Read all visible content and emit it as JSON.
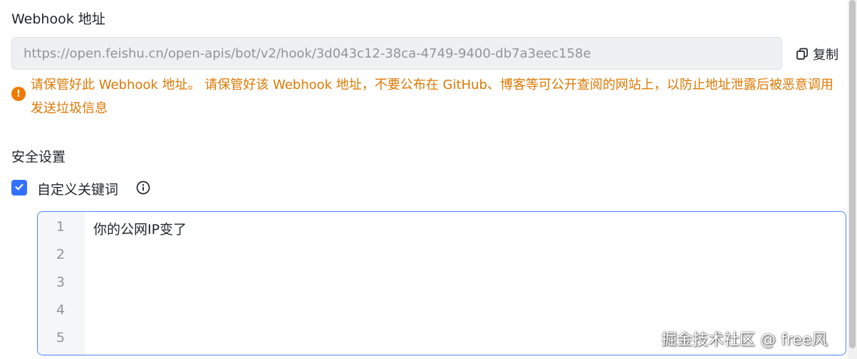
{
  "webhook": {
    "label": "Webhook 地址",
    "url": "https://open.feishu.cn/open-apis/bot/v2/hook/3d043c12-38ca-4749-9400-db7a3eec158e",
    "copy_label": "复制"
  },
  "warning": {
    "icon": "exclamation-icon",
    "text": "请保管好此 Webhook 地址。 请保管好该 Webhook 地址，不要公布在 GitHub、博客等可公开查阅的网站上，以防止地址泄露后被恶意调用发送垃圾信息"
  },
  "security": {
    "label": "安全设置",
    "keyword_option": {
      "label": "自定义关键词",
      "checked": true
    }
  },
  "editor": {
    "line_numbers": [
      "1",
      "2",
      "3",
      "4",
      "5"
    ],
    "lines": [
      "你的公网IP变了"
    ]
  },
  "watermark": "掘金技术社区 @ free风",
  "colors": {
    "accent": "#3370ff",
    "warning": "#de7802",
    "editor_border": "#4e83fd"
  }
}
